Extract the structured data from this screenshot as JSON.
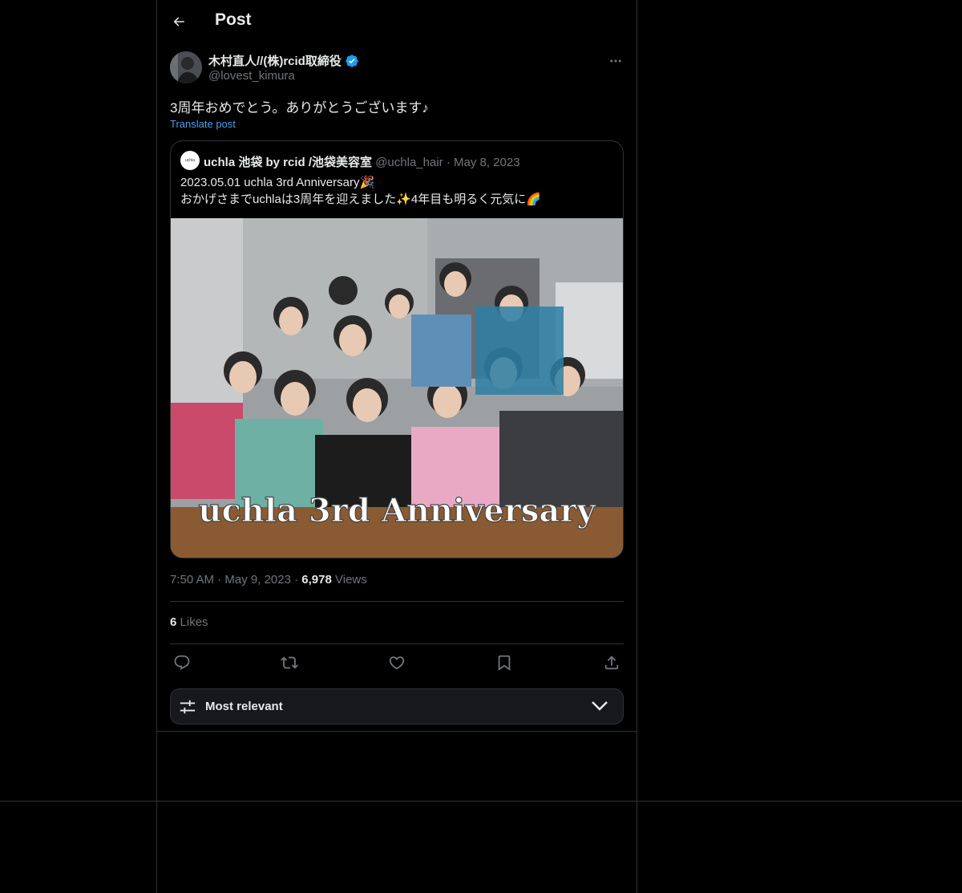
{
  "header": {
    "title": "Post"
  },
  "author": {
    "name": "木村直人//(株)rcid取締役",
    "handle": "@lovest_kimura"
  },
  "post": {
    "text": "3周年おめでとう。ありがとうございます♪",
    "translate_label": "Translate post"
  },
  "quote": {
    "avatar_text": "uchla",
    "name": "uchla 池袋 by rcid /池袋美容室",
    "handle": "@uchla_hair",
    "separator": "·",
    "date": "May 8, 2023",
    "line1": "2023.05.01  uchla 3rd Anniversary🎉",
    "line2": "おかげさまでuchlaは3周年を迎えました✨4年目も明るく元気に🌈",
    "image_caption": "uchla 3rd Anniversary"
  },
  "meta": {
    "time": "7:50 AM",
    "date": "May 9, 2023",
    "separator": "·",
    "views_count": "6,978",
    "views_label": "Views"
  },
  "likes": {
    "count": "6",
    "label": "Likes"
  },
  "actions": [
    "reply-icon",
    "repost-icon",
    "like-icon",
    "bookmark-icon",
    "share-icon"
  ],
  "sort": {
    "label": "Most relevant"
  },
  "colors": {
    "background": "#000000",
    "border": "#2f3336",
    "link": "#4c9ded",
    "verified": "#1d9bf0",
    "dim_text": "#71767b"
  }
}
